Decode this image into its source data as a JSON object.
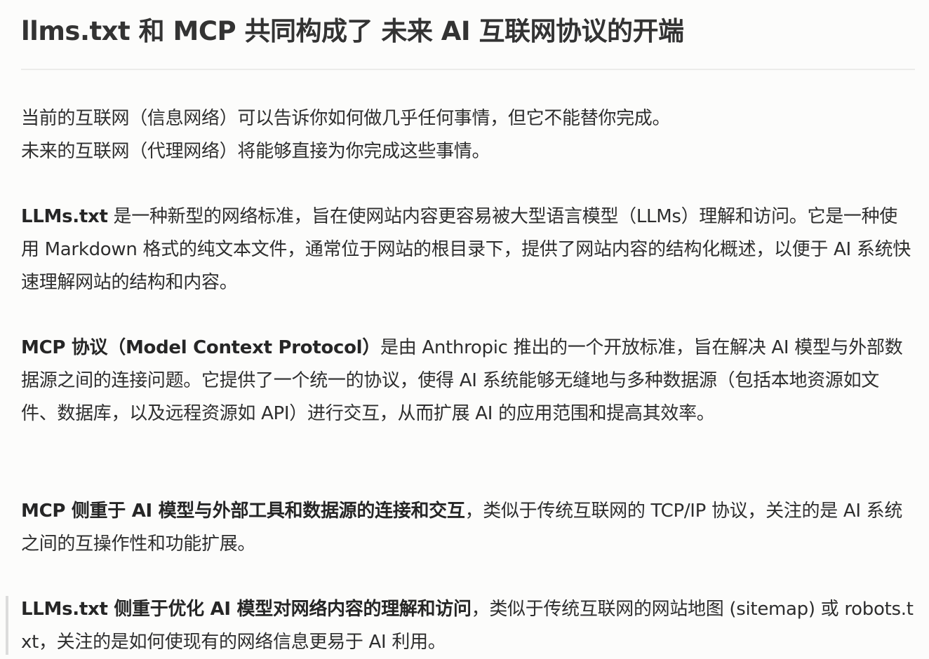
{
  "title": "llms.txt 和 MCP 共同构成了 未来 AI 互联网协议的开端",
  "intro": {
    "line1": "当前的互联网（信息网络）可以告诉你如何做几乎任何事情，但它不能替你完成。",
    "line2": "未来的互联网（代理网络）将能够直接为你完成这些事情。"
  },
  "llms_para": {
    "bold": "LLMs.txt",
    "text": " 是一种新型的网络标准，旨在使网站内容更容易被大型语言模型（LLMs）理解和访问。它是一种使用 Markdown 格式的纯文本文件，通常位于网站的根目录下，提供了网站内容的结构化概述，以便于 AI 系统快速理解网站的结构和内容。"
  },
  "mcp_para": {
    "bold": "MCP 协议（Model Context Protocol）",
    "text": "是由 Anthropic 推出的一个开放标准，旨在解决 AI 模型与外部数据源之间的连接问题。它提供了一个统一的协议，使得 AI 系统能够无缝地与多种数据源（包括本地资源如文件、数据库，以及远程资源如 API）进行交互，从而扩展 AI 的应用范围和提高其效率。"
  },
  "mcp_focus": {
    "bold": "MCP 侧重于 AI 模型与外部工具和数据源的连接和交互",
    "text": "，类似于传统互联网的 TCP/IP 协议，关注的是 AI 系统之间的互操作性和功能扩展。"
  },
  "llms_focus": {
    "bold": "LLMs.txt 侧重于优化 AI 模型对网络内容的理解和访问",
    "text": "，类似于传统互联网的网站地图 (sitemap) 或 robots.txt，关注的是如何使现有的网络信息更易于 AI 利用。"
  }
}
